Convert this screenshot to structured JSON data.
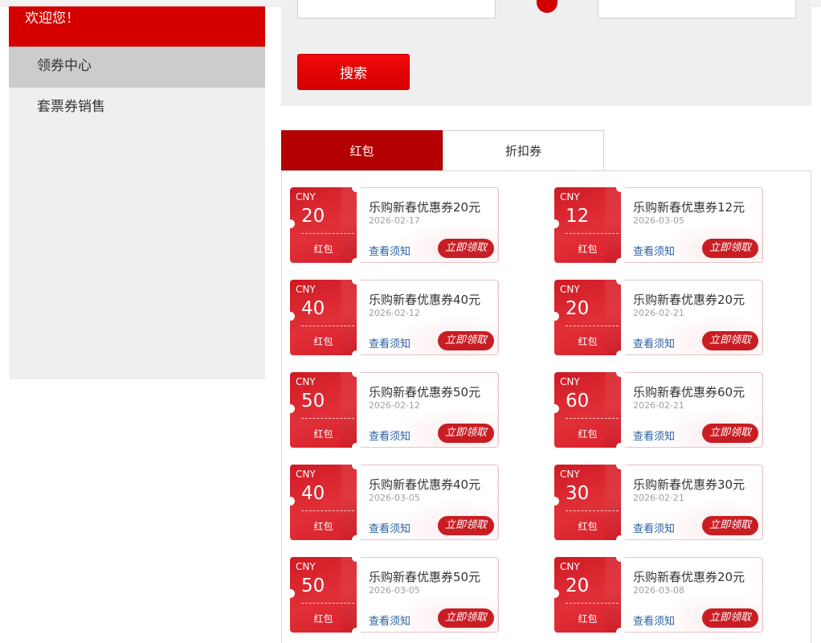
{
  "sidebar": {
    "welcome": "欢迎您！",
    "items": [
      {
        "label": "领券中心",
        "active": true
      },
      {
        "label": "套票券销售",
        "active": false
      }
    ]
  },
  "search": {
    "button_label": "搜索"
  },
  "tabs": [
    {
      "label": "红包",
      "active": true
    },
    {
      "label": "折扣券",
      "active": false
    }
  ],
  "coupon_labels": {
    "notice": "查看须知",
    "claim": "立即领取"
  },
  "coupons": [
    {
      "currency": "CNY",
      "amount": "20",
      "type": "红包",
      "title": "乐购新春优惠券20元",
      "date": "2026-02-17"
    },
    {
      "currency": "CNY",
      "amount": "12",
      "type": "红包",
      "title": "乐购新春优惠券12元",
      "date": "2026-03-05"
    },
    {
      "currency": "CNY",
      "amount": "40",
      "type": "红包",
      "title": "乐购新春优惠券40元",
      "date": "2026-02-12"
    },
    {
      "currency": "CNY",
      "amount": "20",
      "type": "红包",
      "title": "乐购新春优惠券20元",
      "date": "2026-02-21"
    },
    {
      "currency": "CNY",
      "amount": "50",
      "type": "红包",
      "title": "乐购新春优惠券50元",
      "date": "2026-02-12"
    },
    {
      "currency": "CNY",
      "amount": "60",
      "type": "红包",
      "title": "乐购新春优惠券60元",
      "date": "2026-02-21"
    },
    {
      "currency": "CNY",
      "amount": "40",
      "type": "红包",
      "title": "乐购新春优惠券40元",
      "date": "2026-03-05"
    },
    {
      "currency": "CNY",
      "amount": "30",
      "type": "红包",
      "title": "乐购新春优惠券30元",
      "date": "2026-02-21"
    },
    {
      "currency": "CNY",
      "amount": "50",
      "type": "红包",
      "title": "乐购新春优惠券50元",
      "date": "2026-03-05"
    },
    {
      "currency": "CNY",
      "amount": "20",
      "type": "红包",
      "title": "乐购新春优惠券20元",
      "date": "2026-03-08"
    }
  ],
  "colors": {
    "brand_red": "#d40000",
    "tab_active": "#b30000",
    "claim_button": "#c91d24",
    "link_blue": "#2b5f9e"
  }
}
